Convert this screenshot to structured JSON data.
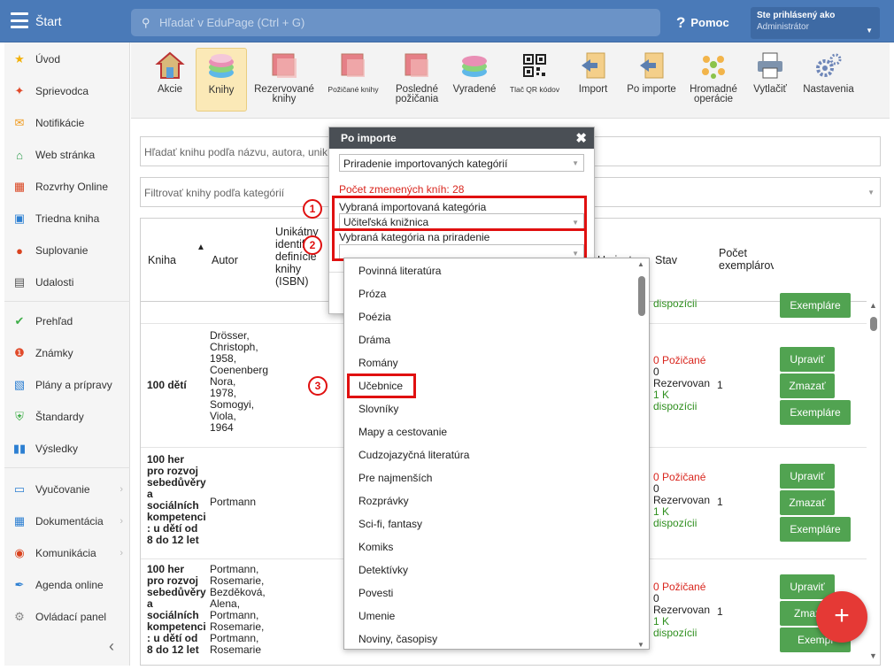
{
  "topbar": {
    "brand": "Štart",
    "search_placeholder": "Hľadať v EduPage (Ctrl + G)",
    "help": "Pomoc",
    "user_line1": "Ste prihlásený ako",
    "user_line2": "Administrátor"
  },
  "sidebar": {
    "items": [
      {
        "label": "Úvod",
        "icon": "star-icon",
        "color": "#f2b10a"
      },
      {
        "label": "Sprievodca",
        "icon": "wand-icon",
        "color": "#e14a2a"
      },
      {
        "label": "Notifikácie",
        "icon": "envelope-icon",
        "color": "#f09a1c"
      },
      {
        "label": "Web stránka",
        "icon": "home-icon",
        "color": "#2b9a4a"
      },
      {
        "label": "Rozvrhy Online",
        "icon": "grid-icon",
        "color": "#d9431f"
      },
      {
        "label": "Triedna kniha",
        "icon": "book-icon",
        "color": "#2c7fd2"
      },
      {
        "label": "Suplovanie",
        "icon": "person-icon",
        "color": "#d9431f"
      },
      {
        "label": "Udalosti",
        "icon": "calendar-icon",
        "color": "#555555"
      },
      {
        "label": "Prehľad",
        "icon": "check-circle-icon",
        "color": "#3fae49"
      },
      {
        "label": "Známky",
        "icon": "grade-icon",
        "color": "#e14a2a"
      },
      {
        "label": "Plány a prípravy",
        "icon": "briefcase-icon",
        "color": "#2c7fd2"
      },
      {
        "label": "Štandardy",
        "icon": "shield-icon",
        "color": "#3fae49"
      },
      {
        "label": "Výsledky",
        "icon": "bar-chart-icon",
        "color": "#2c7fd2"
      },
      {
        "label": "Vyučovanie",
        "icon": "open-book-icon",
        "color": "#2c7fd2"
      },
      {
        "label": "Dokumentácia",
        "icon": "document-icon",
        "color": "#2c7fd2"
      },
      {
        "label": "Komunikácia",
        "icon": "chat-icon",
        "color": "#d9431f"
      },
      {
        "label": "Agenda online",
        "icon": "pen-icon",
        "color": "#2c7fd2"
      },
      {
        "label": "Ovládací panel",
        "icon": "gear-icon",
        "color": "#888888"
      }
    ]
  },
  "toolbar": {
    "items": [
      {
        "label": "Akcie"
      },
      {
        "label": "Knihy"
      },
      {
        "label": "Rezervované knihy"
      },
      {
        "label": "Požičané knihy"
      },
      {
        "label": "Posledné požičania"
      },
      {
        "label": "Vyradené"
      },
      {
        "label": "Tlač QR kódov"
      },
      {
        "label": "Import"
      },
      {
        "label": "Po importe"
      },
      {
        "label": "Hromadné operácie"
      },
      {
        "label": "Vytlačiť"
      },
      {
        "label": "Nastavenia"
      }
    ]
  },
  "filters": {
    "search_placeholder": "Hľadať knihu podľa názvu, autora, unik",
    "category_placeholder": "Filtrovať knihy podľa kategórií"
  },
  "table": {
    "headers": {
      "kniha": "Kniha",
      "autor": "Autor",
      "isbn": [
        "Unikátny",
        "identif",
        "definície",
        "knihy",
        "(ISBN)"
      ],
      "umiestnenie": "Umiestnen",
      "stav": "Stav",
      "pocet": [
        "Počet",
        "exemplárov"
      ]
    },
    "partial_row": {
      "stav_tail": "dispozícii",
      "exemplare": "Exempláre"
    },
    "rows": [
      {
        "kniha": [
          "100 dětí"
        ],
        "autor": [
          "Drösser,",
          "Christoph,",
          "1958,",
          "Coenenberg",
          "Nora,",
          "1978,",
          "Somogyi,",
          "Viola,",
          "1964"
        ],
        "stav_red": "0 Požičané",
        "stav_lines": [
          "0",
          "Rezervovan"
        ],
        "stav_green": [
          "1 K",
          "dispozícii"
        ],
        "count": "1",
        "btn_edit": "Upraviť",
        "btn_delete": "Zmazať",
        "btn_copies": "Exempláre"
      },
      {
        "kniha": [
          "100 her",
          "pro rozvoj",
          "sebedůvěry",
          "a",
          "sociálních",
          "kompetenci",
          ": u dětí od",
          "8 do 12 let"
        ],
        "autor": [
          "Portmann"
        ],
        "stav_red": "0 Požičané",
        "stav_lines": [
          "0",
          "Rezervovan"
        ],
        "stav_green": [
          "1 K",
          "dispozícii"
        ],
        "count": "1",
        "btn_edit": "Upraviť",
        "btn_delete": "Zmazať",
        "btn_copies": "Exempláre"
      },
      {
        "kniha": [
          "100 her",
          "pro rozvoj",
          "sebedůvěry",
          "a",
          "sociálních",
          "kompetenci",
          ": u dětí od",
          "8 do 12 let"
        ],
        "autor": [
          "Portmann,",
          "Rosemarie,",
          "Bezděková,",
          "Alena,",
          "Portmann,",
          "Rosemarie,",
          "Portmann,",
          "Rosemarie"
        ],
        "stav_red": "0 Požičané",
        "stav_lines": [
          "0",
          "Rezervovan"
        ],
        "stav_green": [
          "1 K",
          "dispozícii"
        ],
        "count": "1",
        "btn_edit": "Upraviť",
        "btn_delete": "Zmaz",
        "btn_copies": "Exempl"
      }
    ]
  },
  "modal": {
    "title": "Po importe",
    "select_action": "Priradenie importovaných kategórií",
    "count_text": "Počet zmenených kníh: 28",
    "imported_label": "Vybraná importovaná kategória",
    "imported_value": "Učiteľská knižnica",
    "target_label": "Vybraná kategória na priradenie",
    "target_value": ""
  },
  "dropdown": {
    "options": [
      "Povinná literatúra",
      "Próza",
      "Poézia",
      "Dráma",
      "Romány",
      "Učebnice",
      "Slovníky",
      "Mapy a cestovanie",
      "Cudzojazyčná literatúra",
      "Pre najmenších",
      "Rozprávky",
      "Sci-fi, fantasy",
      "Komiks",
      "Detektívky",
      "Povesti",
      "Umenie",
      "Noviny, časopisy"
    ],
    "highlighted": "Učebnice"
  },
  "markers": [
    "1",
    "2",
    "3"
  ],
  "fab": "+",
  "colors": {
    "topbar": "#4a7ab8",
    "highlight_red": "#e01010",
    "button_green": "#51a351",
    "status_red": "#d9251d",
    "status_green": "#2f8f1f"
  }
}
